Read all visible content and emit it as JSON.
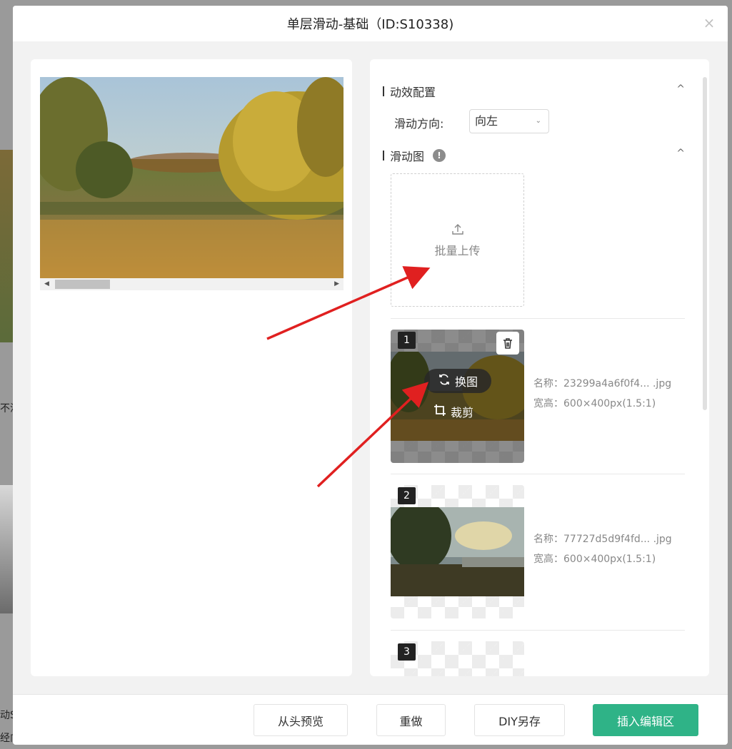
{
  "modal": {
    "title": "单层滑动-基础（ID:S10338)",
    "close_glyph": "×"
  },
  "background": {
    "text1": "不滑",
    "text2": "动S\\",
    "text3": "经向"
  },
  "config": {
    "section_title": "动效配置",
    "direction_label": "滑动方向:",
    "direction_value": "向左",
    "images_section_title": "滑动图",
    "info_glyph": "!",
    "caret": "^"
  },
  "upload": {
    "icon": "upload-icon",
    "label": "批量上传"
  },
  "images": [
    {
      "index": "1",
      "name_line": "名称：23299a4a6f0f4... .jpg",
      "size_line": "宽高：600×400px(1.5:1)",
      "swap_label": "换图",
      "crop_label": "裁剪"
    },
    {
      "index": "2",
      "name_line": "名称：77727d5d9f4fd... .jpg",
      "size_line": "宽高：600×400px(1.5:1)"
    },
    {
      "index": "3"
    }
  ],
  "footer": {
    "preview_label": "从头预览",
    "redo_label": "重做",
    "diy_save_label": "DIY另存",
    "insert_label": "插入编辑区"
  },
  "colors": {
    "primary": "#2fb387",
    "arrow": "#e02020"
  }
}
